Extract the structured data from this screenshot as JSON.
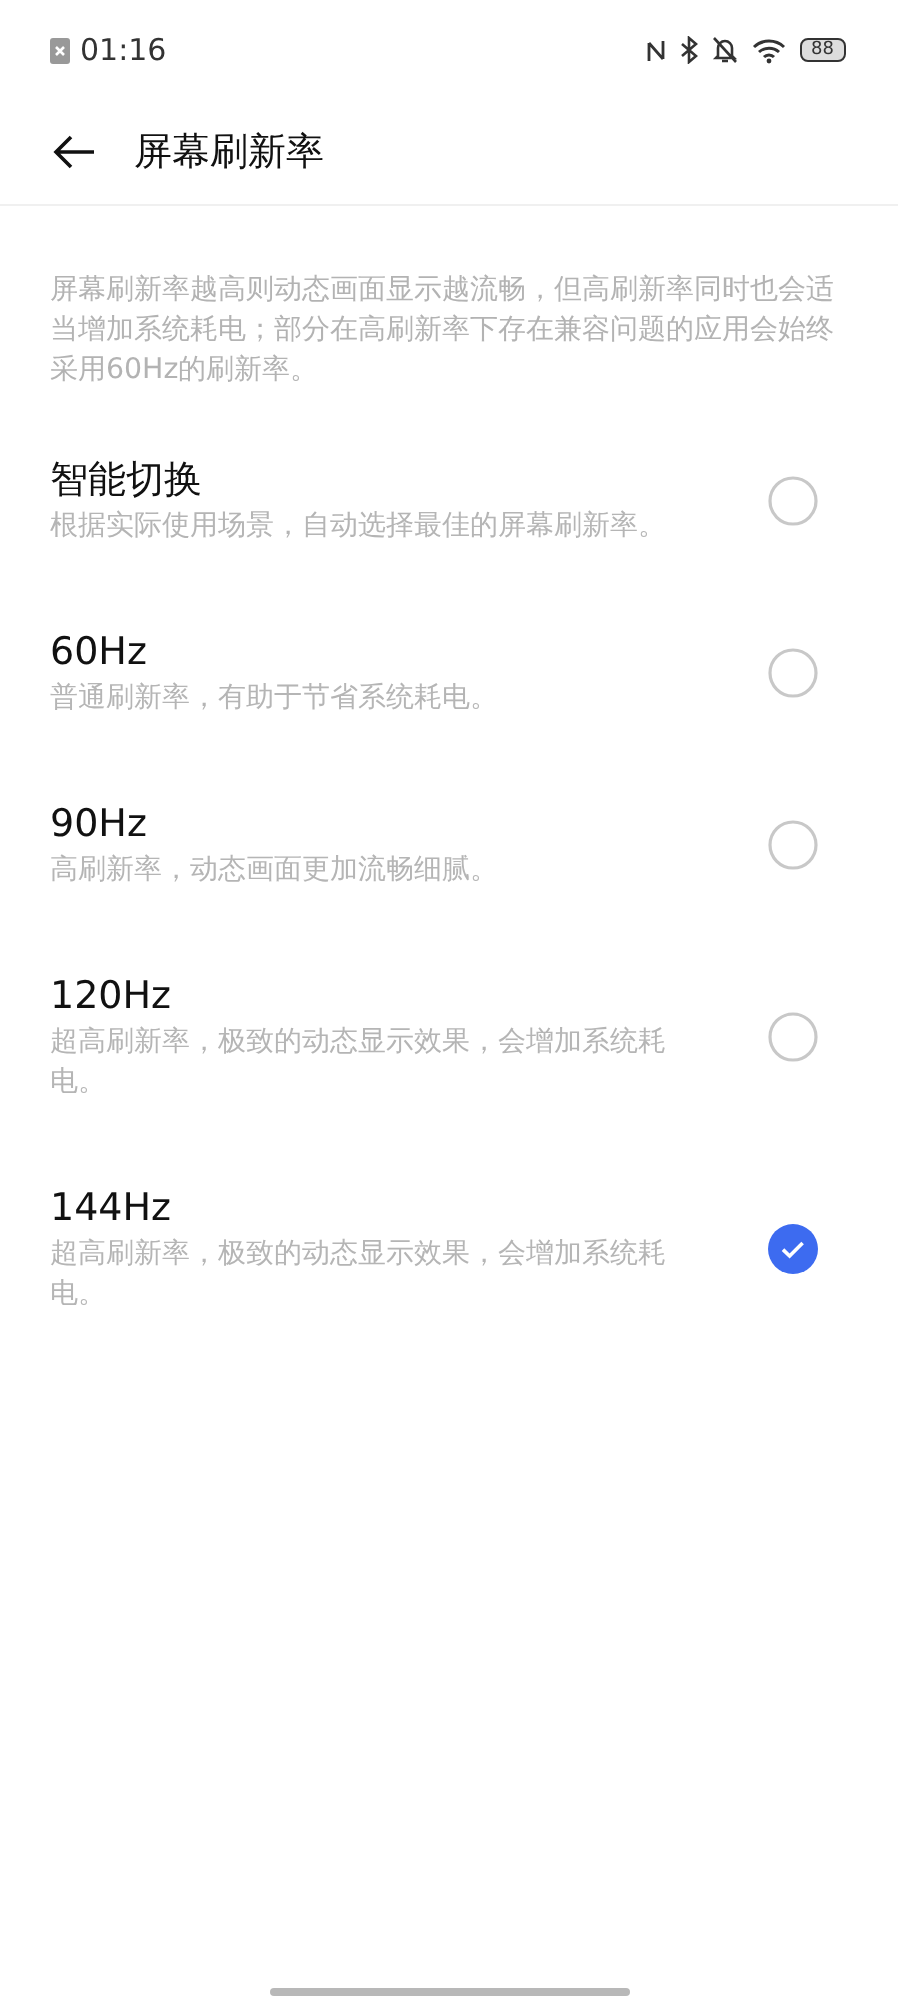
{
  "status_bar": {
    "time": "01:16",
    "battery": "88"
  },
  "header": {
    "title": "屏幕刷新率"
  },
  "description": "屏幕刷新率越高则动态画面显示越流畅，但高刷新率同时也会适当增加系统耗电；部分在高刷新率下存在兼容问题的应用会始终采用60Hz的刷新率。",
  "options": [
    {
      "title": "智能切换",
      "subtitle": "根据实际使用场景，自动选择最佳的屏幕刷新率。",
      "selected": false
    },
    {
      "title": "60Hz",
      "subtitle": "普通刷新率，有助于节省系统耗电。",
      "selected": false
    },
    {
      "title": "90Hz",
      "subtitle": "高刷新率，动态画面更加流畅细腻。",
      "selected": false
    },
    {
      "title": "120Hz",
      "subtitle": "超高刷新率，极致的动态显示效果，会增加系统耗电。",
      "selected": false
    },
    {
      "title": "144Hz",
      "subtitle": "超高刷新率，极致的动态显示效果，会增加系统耗电。",
      "selected": true
    }
  ]
}
